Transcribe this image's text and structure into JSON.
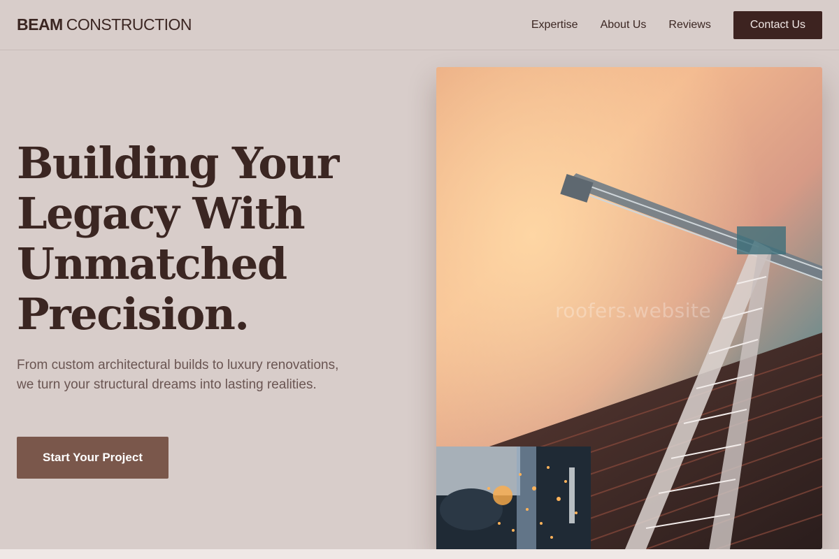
{
  "brand": {
    "name_bold": "BEAM",
    "name_light": "CONSTRUCTION"
  },
  "nav": {
    "links": [
      "Expertise",
      "About Us",
      "Reviews"
    ],
    "contact_label": "Contact Us"
  },
  "hero": {
    "title_lines": [
      "Building Your",
      "Legacy With",
      "Unmatched",
      "Precision."
    ],
    "subtitle": "From custom architectural builds to luxury renovations, we turn your structural dreams into lasting realities.",
    "cta_label": "Start Your Project",
    "watermark": "roofers.website"
  },
  "colors": {
    "background": "#d8cdca",
    "text_dark": "#3b2622",
    "contact_button": "#3d2320",
    "cta_button": "#7a574b"
  }
}
